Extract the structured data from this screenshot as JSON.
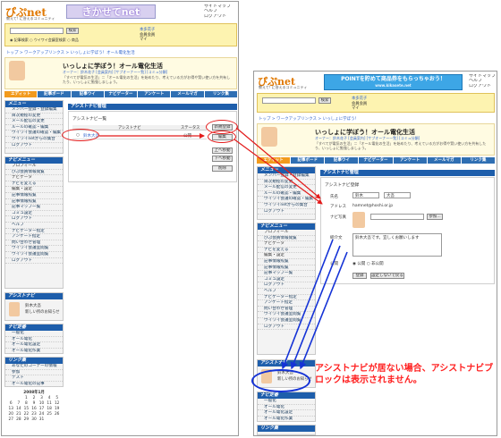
{
  "left": {
    "logo": "ぴぷnet",
    "tagline": "教えて! に答えるコミュニティ",
    "banner": "きかせてnet",
    "side_nav": [
      "サイトマップ",
      "ヘルプ",
      "ログアウト"
    ],
    "user_lines": [
      "本多花子",
      "会員会員",
      "マイ"
    ],
    "search_button": "検索",
    "search_options": [
      "記事検索",
      "ウイワイ会議室検索",
      "商品"
    ],
    "breadcrumb": "トップ > ワークアップリンクス > いっしょに学ぼう！オール電化生活",
    "topic_title": "いっしょに学ぼう！オール電化生活",
    "topic_meta": "オーナー：鈴木花子 [会員案内] [サブオーナー一覧] [コミュ分類]",
    "topic_text": "「すべてが電気の生活」＝「オール電化の生活」を始めたり、考えている方がお得や賢い使い方を共有したり、いっしょに勉強しましょう。",
    "tabs": [
      "エディット",
      "記事ボード",
      "記事ウイ",
      "ナビゲーター",
      "アンケート",
      "メールマガ",
      "リンク集"
    ],
    "menu_title": "メニュー",
    "menu_items": [
      "メンバー登録・登録編集",
      "目次規程の変更",
      "メール配信の変更",
      "ルールの確認・編集",
      "ウイワイ会議の確認・編集",
      "ウイワイnetからの集合",
      "ログアウト"
    ],
    "menu2_title": "ナビメニュー",
    "menu2_items": [
      "プロフィール",
      "ぴぷ会員情報閲覧",
      "ナビゲータ",
      "ナビを変える",
      "編集・設定",
      "記事情報照覧",
      "記事情報照覧",
      "記事マップ一覧",
      "コミュ設定",
      "ログアウト",
      "ヘルプ",
      "ナビゲーター指定",
      "アンケート指定",
      "問い合わせ管理",
      "ウイワイ会議室閲覧",
      "ウイワイ会議室閲覧",
      "ログアウト"
    ],
    "assist_box_title": "アシストナビ",
    "assist_box_name": "鈴木大吾",
    "assist_box_text": "新しい所のお知らせ",
    "pref_title": "ナビ定番",
    "pref_items": [
      "一般化",
      "オール電化",
      "オール電化設定",
      "オール電化作業"
    ],
    "link_title": "リンク集",
    "link_items": [
      "あなたのコーナーの情報",
      "参加",
      "テスト",
      "オール電化の記事"
    ],
    "calendar_title": "2008年1月",
    "calendar_rows": [
      [
        "",
        "",
        "1",
        "2",
        "3",
        "4",
        "5"
      ],
      [
        "6",
        "7",
        "8",
        "9",
        "10",
        "11",
        "12"
      ],
      [
        "13",
        "14",
        "15",
        "16",
        "17",
        "18",
        "19"
      ],
      [
        "20",
        "21",
        "22",
        "23",
        "24",
        "25",
        "26"
      ],
      [
        "27",
        "28",
        "29",
        "30",
        "31",
        "",
        ""
      ]
    ],
    "main_heading": "アシストナビ管理",
    "sub_heading": "アシストナビ一覧",
    "col_heads": [
      "アシストナビ",
      "ステータス"
    ],
    "row_name": "鈴木大吾",
    "row_status": "公開",
    "buttons": [
      "新規登録",
      "編集",
      "上へ移動",
      "下へ移動",
      "削除"
    ]
  },
  "right": {
    "logo": "ぴぷnet",
    "tagline": "教えて! に答えるコミュニティ",
    "banner": "POINTを貯めて商品券をもらっちゃおう！",
    "banner_url": "www.kikasete.net",
    "side_nav": [
      "サイトマップ",
      "ヘルプ",
      "ログアウト"
    ],
    "search_button": "検索",
    "user_lines": [
      "本多花子",
      "会員会員",
      "マイ"
    ],
    "breadcrumb": "トップ > ワークアップリンクス > いっしょに学ぼう！",
    "topic_title": "いっしょに学ぼう！オール電化生活",
    "topic_meta": "オーナー：鈴木花子 [会員案内] [サブオーナー一覧] [コミュ分類]",
    "topic_text": "「すべてが電気の生活」＝「オール電化の生活」を始めたり、考えている方がお得や賢い使い方を共有したり、いっしょに勉強しましょう。",
    "tabs": [
      "エディット",
      "記事ボード",
      "記事ウイ",
      "ナビゲーター",
      "アンケート",
      "メールマガ",
      "リンク集"
    ],
    "menu_title": "メニュー",
    "menu_items": [
      "メンバー登録・登録編集",
      "目次規程の変更",
      "メール配信の変更",
      "ルールの確認・編集",
      "ウイワイ会議の確認・編集",
      "ウイワイnetからの集合",
      "ログアウト"
    ],
    "menu2_title": "ナビメニュー",
    "menu2_items": [
      "プロフィール",
      "ぴぷ会員情報閲覧",
      "ナビゲータ",
      "ナビを変える",
      "編集・設定",
      "記事情報照覧",
      "記事情報照覧",
      "記事マップ一覧",
      "コミュ設定",
      "ログアウト",
      "ヘルプ",
      "ナビゲーター指定",
      "アンケート指定",
      "問い合わせ管理",
      "ウイワイ会議室閲覧",
      "ウイワイ会議室閲覧",
      "ログアウト"
    ],
    "main_heading": "アシストナビ管理",
    "sub_heading": "アシストナビ登録",
    "form_labels": [
      "氏名",
      "アドレス",
      "ナビ写真",
      "紹介文",
      "公開"
    ],
    "form_name_values": [
      "鈴木",
      "大吾"
    ],
    "form_email": "hamnet@hoshi.or.jp",
    "browse_button": "参照...",
    "intro_text": "鈴木大吾です。宜しくお願いします",
    "publish_options": [
      "公開",
      "非公開"
    ],
    "submit_buttons": [
      "登録",
      "設定しないで戻る"
    ],
    "assist_box_title": "アシストナビ",
    "assist_box_name": "鈴木大吾",
    "assist_box_text": "新しい所のお知らせ",
    "pref_title": "ナビ定番",
    "pref_items": [
      "一般化",
      "オール電化",
      "オール電化設定",
      "オール電化作業"
    ],
    "link_title": "リンク集"
  },
  "annotation": "アシストナビが居ない場合、アシストナビブロックは表示されません。"
}
